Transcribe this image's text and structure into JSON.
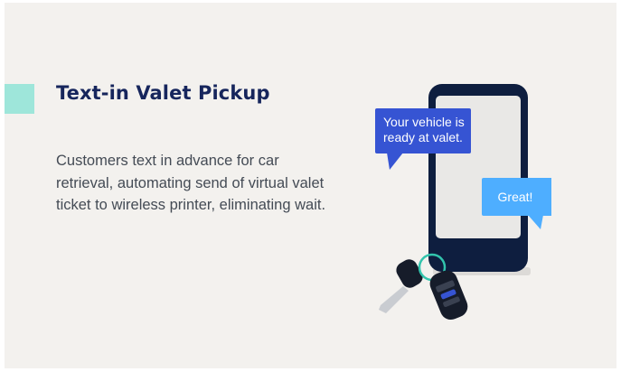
{
  "feature": {
    "title": "Text-in Valet Pickup",
    "description": "Customers text in advance for car retrieval, automating send of virtual valet ticket to wireless printer, eliminating wait."
  },
  "illustration": {
    "message_from_valet": "Your vehicle is ready at valet.",
    "reply_from_customer": "Great!",
    "icons": [
      "smartphone-icon",
      "chat-bubble-icon",
      "car-key-fob-icon"
    ]
  },
  "colors": {
    "card_background": "#f3f1ee",
    "accent": "#9ee6da",
    "title": "#16255c",
    "body_text": "#444b55",
    "phone_frame": "#0e1e3f",
    "phone_screen": "#e9e8e6",
    "valet_bubble": "#3654d3",
    "reply_bubble": "#4eaeff"
  }
}
